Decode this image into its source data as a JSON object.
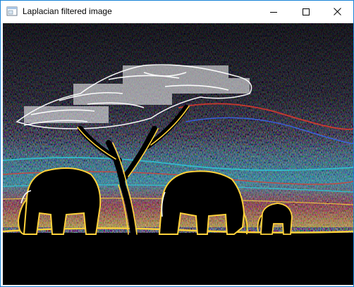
{
  "window": {
    "title": "Laplacian filtered image",
    "accent_color": "#1883d7"
  },
  "titlebar": {
    "icon": "app-window-icon",
    "minimize_icon": "minimize-icon",
    "maximize_icon": "maximize-icon",
    "close_icon": "close-icon"
  },
  "image": {
    "subject": "Laplacian filtered image",
    "background_color": "#000000",
    "edge_colors": [
      "#ffffff",
      "#ffd23a",
      "#e23b2e",
      "#2ec8d8",
      "#3a6cff"
    ]
  }
}
